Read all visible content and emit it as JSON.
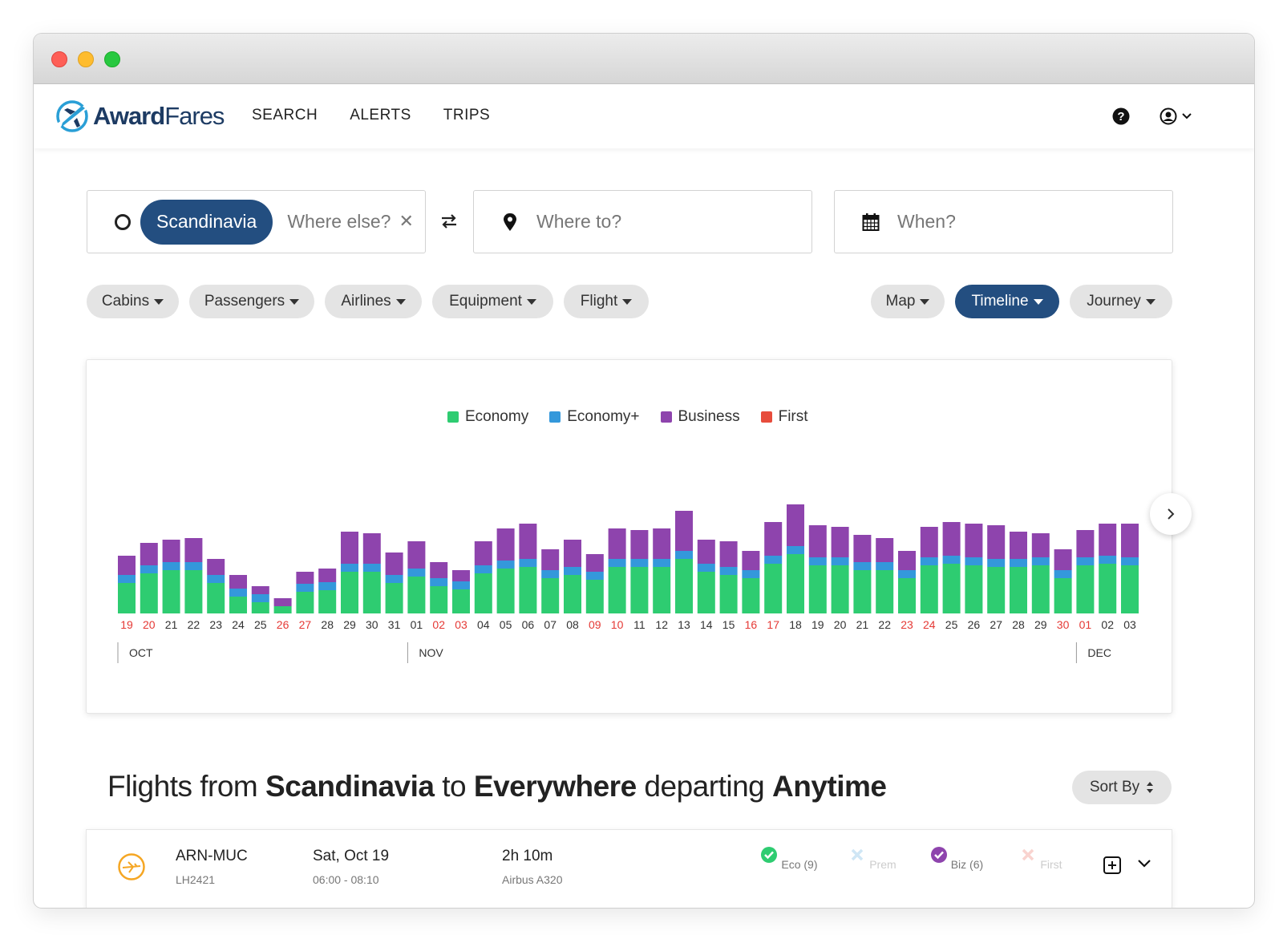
{
  "brand": {
    "name_bold": "Award",
    "name_light": "Fares",
    "logo_icon": "plane-circle-icon"
  },
  "nav": {
    "links": [
      "SEARCH",
      "ALERTS",
      "TRIPS"
    ],
    "help_icon": "question-circle-icon",
    "user_icon": "user-circle-icon"
  },
  "search": {
    "origin_chip": "Scandinavia",
    "origin_placeholder": "Where else?",
    "destination_placeholder": "Where to?",
    "date_placeholder": "When?"
  },
  "filters": {
    "left": [
      "Cabins",
      "Passengers",
      "Airlines",
      "Equipment",
      "Flight"
    ],
    "views": [
      "Map",
      "Timeline",
      "Journey"
    ],
    "active_view": "Timeline"
  },
  "colors": {
    "economy": "#2ecc71",
    "economy_plus": "#3498db",
    "business": "#8e44ad",
    "first": "#e74c3c",
    "brand": "#234e80"
  },
  "chart_data": {
    "type": "bar",
    "stacked": true,
    "legend": [
      "Economy",
      "Economy+",
      "Business",
      "First"
    ],
    "categories": [
      "19",
      "20",
      "21",
      "22",
      "23",
      "24",
      "25",
      "26",
      "27",
      "28",
      "29",
      "30",
      "31",
      "01",
      "02",
      "03",
      "04",
      "05",
      "06",
      "07",
      "08",
      "09",
      "10",
      "11",
      "12",
      "13",
      "14",
      "15",
      "16",
      "17",
      "18",
      "19",
      "20",
      "21",
      "22",
      "23",
      "24",
      "25",
      "26",
      "27",
      "28",
      "29",
      "30",
      "01",
      "02",
      "03"
    ],
    "weekend": [
      true,
      true,
      false,
      false,
      false,
      false,
      false,
      true,
      true,
      false,
      false,
      false,
      false,
      false,
      true,
      true,
      false,
      false,
      false,
      false,
      false,
      true,
      true,
      false,
      false,
      false,
      false,
      false,
      true,
      true,
      false,
      false,
      false,
      false,
      false,
      true,
      true,
      false,
      false,
      false,
      false,
      false,
      true,
      true,
      false,
      false
    ],
    "months": [
      {
        "label": "OCT",
        "start_index": 0
      },
      {
        "label": "NOV",
        "start_index": 13
      },
      {
        "label": "DEC",
        "start_index": 43
      }
    ],
    "series": [
      {
        "name": "Economy",
        "values": [
          38,
          50,
          54,
          54,
          38,
          21,
          14,
          9,
          27,
          29,
          52,
          52,
          38,
          46,
          34,
          30,
          50,
          56,
          58,
          44,
          48,
          42,
          58,
          58,
          58,
          68,
          52,
          48,
          44,
          62,
          74,
          60,
          60,
          54,
          54,
          44,
          60,
          62,
          60,
          58,
          58,
          60,
          44,
          60,
          62,
          60
        ]
      },
      {
        "name": "Economy+",
        "values": [
          10,
          10,
          10,
          10,
          10,
          10,
          10,
          0,
          10,
          10,
          10,
          10,
          10,
          10,
          10,
          10,
          10,
          10,
          10,
          10,
          10,
          10,
          10,
          10,
          10,
          10,
          10,
          10,
          10,
          10,
          10,
          10,
          10,
          10,
          10,
          10,
          10,
          10,
          10,
          10,
          10,
          10,
          10,
          10,
          10,
          10
        ]
      },
      {
        "name": "Business",
        "values": [
          24,
          28,
          28,
          30,
          20,
          17,
          10,
          10,
          15,
          17,
          40,
          38,
          28,
          34,
          20,
          14,
          30,
          40,
          44,
          26,
          34,
          22,
          38,
          36,
          38,
          50,
          30,
          32,
          24,
          42,
          52,
          40,
          38,
          34,
          30,
          24,
          38,
          42,
          42,
          42,
          34,
          30,
          26,
          34,
          40,
          42
        ]
      },
      {
        "name": "First",
        "values": [
          0,
          0,
          0,
          0,
          0,
          0,
          0,
          0,
          0,
          0,
          0,
          0,
          0,
          0,
          0,
          0,
          0,
          0,
          0,
          0,
          0,
          0,
          0,
          0,
          0,
          0,
          0,
          0,
          0,
          0,
          0,
          0,
          0,
          0,
          0,
          0,
          0,
          0,
          0,
          0,
          0,
          0,
          0,
          0,
          0,
          0
        ]
      }
    ]
  },
  "results": {
    "title_parts": [
      "Flights from ",
      "Scandinavia",
      " to ",
      "Everywhere",
      " departing ",
      "Anytime"
    ],
    "sort_label": "Sort By"
  },
  "flights": [
    {
      "route": "ARN-MUC",
      "flight_no": "LH2421",
      "date": "Sat, Oct 19",
      "time": "06:00 - 08:10",
      "duration": "2h 10m",
      "aircraft": "Airbus A320",
      "cabins": [
        {
          "label": "Eco (9)",
          "available": true,
          "color": "#2ecc71"
        },
        {
          "label": "Prem",
          "available": false,
          "color": "#3498db"
        },
        {
          "label": "Biz (6)",
          "available": true,
          "color": "#8e44ad"
        },
        {
          "label": "First",
          "available": false,
          "color": "#e74c3c"
        }
      ]
    }
  ]
}
